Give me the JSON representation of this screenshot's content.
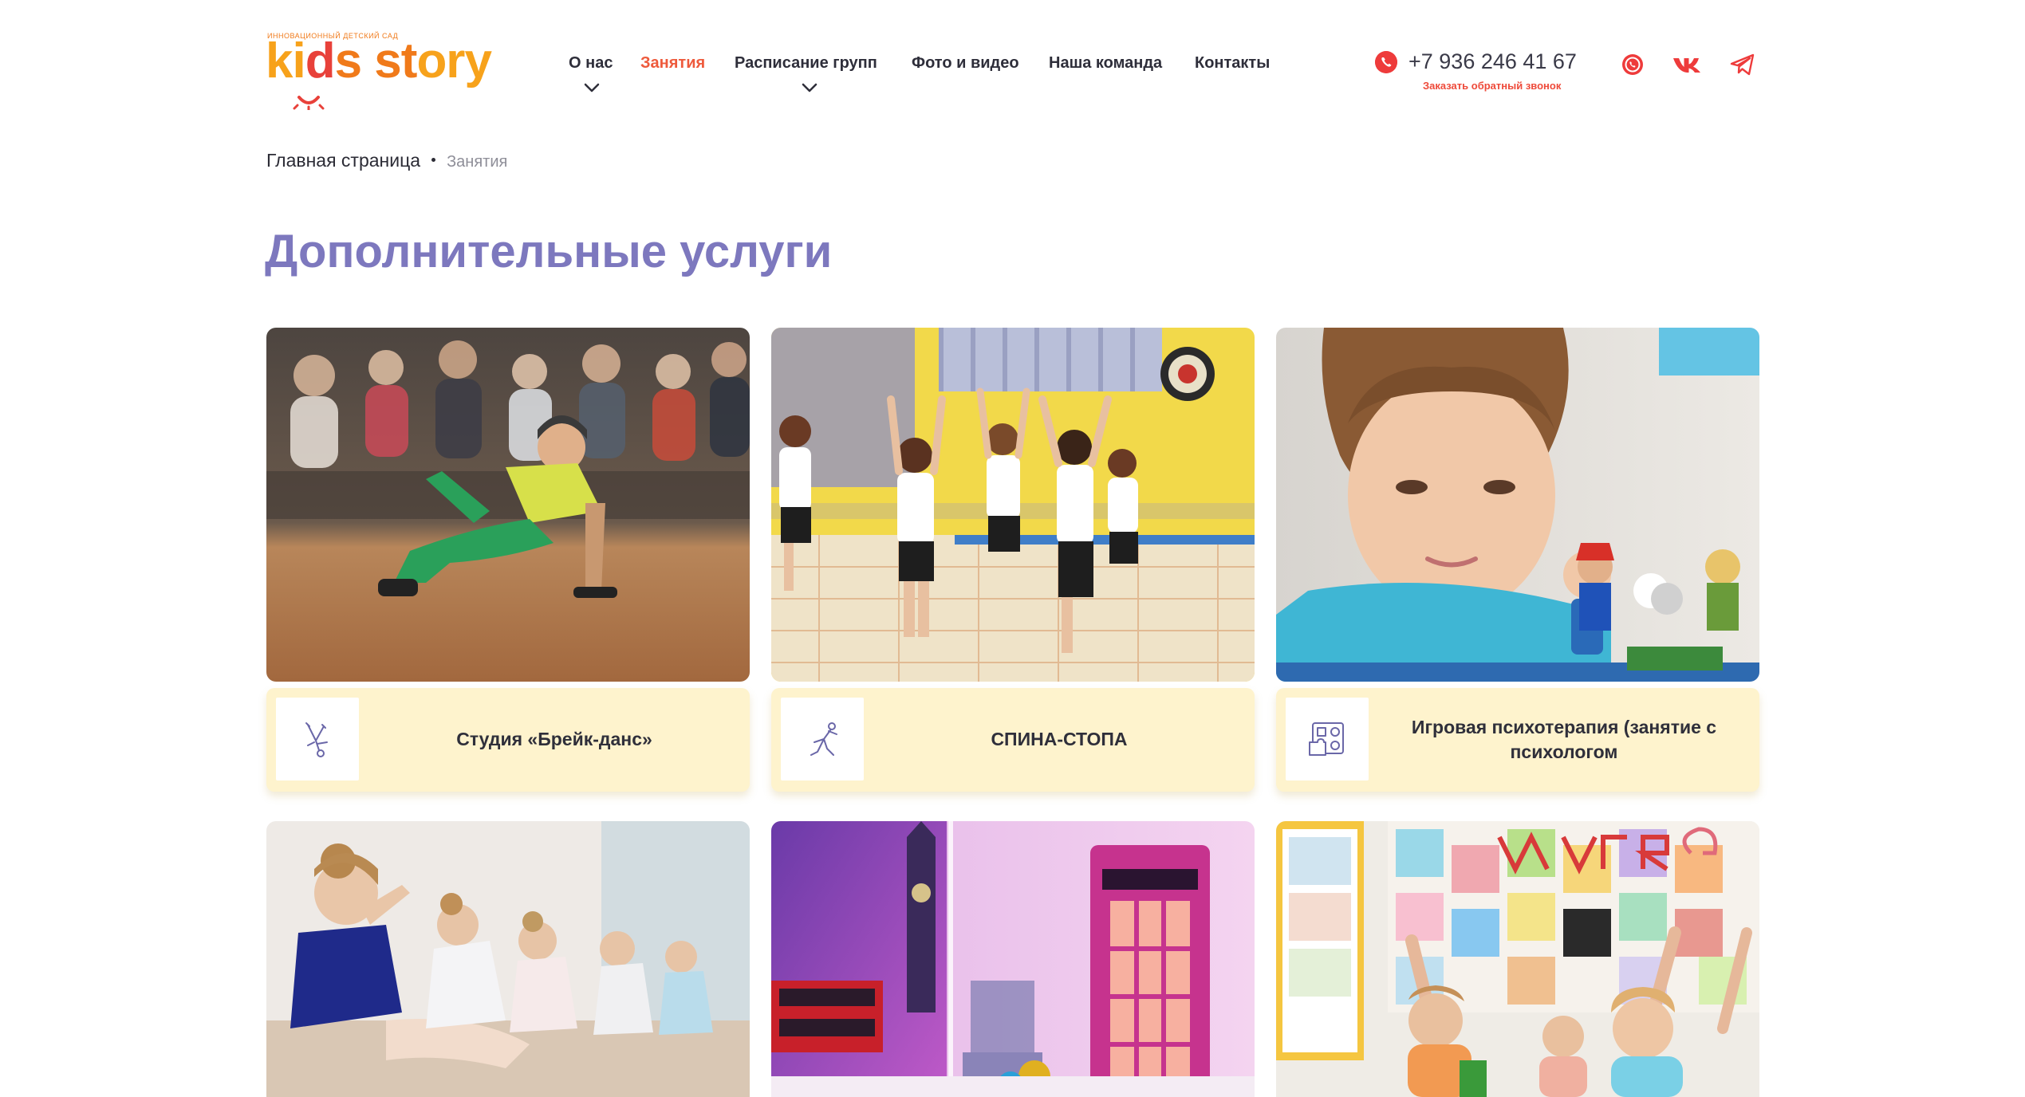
{
  "header": {
    "logo": {
      "tagline": "Инновационный детский сад",
      "word_part1": "ki",
      "word_part2": "d",
      "word_part3": "s st",
      "word_part4": "ory"
    },
    "nav": [
      {
        "label": "О нас",
        "has_dropdown": true,
        "active": false
      },
      {
        "label": "Занятия",
        "has_dropdown": false,
        "active": true
      },
      {
        "label": "Расписание групп",
        "has_dropdown": true,
        "active": false
      },
      {
        "label": "Фото и видео",
        "has_dropdown": false,
        "active": false
      },
      {
        "label": "Наша команда",
        "has_dropdown": false,
        "active": false
      },
      {
        "label": "Контакты",
        "has_dropdown": false,
        "active": false
      }
    ],
    "phone": "+7 936 246 41 67",
    "callback_label": "Заказать обратный звонок",
    "social_icons": [
      "whatsapp-icon",
      "vk-icon",
      "telegram-icon"
    ]
  },
  "breadcrumb": {
    "home": "Главная страница",
    "current": "Занятия"
  },
  "page_title": "Дополнительные услуги",
  "cards": [
    {
      "title": "Студия «Брейк-данс»",
      "icon": "breakdance-icon",
      "image": "boy breakdancing in a gym"
    },
    {
      "title": "СПИНА-СТОПА",
      "icon": "stretching-icon",
      "image": "children exercising in a yellow gym"
    },
    {
      "title": "Игровая психотерапия (занятие с психологом",
      "icon": "puzzle-icon",
      "image": "toddler playing with toy figures"
    },
    {
      "title": "",
      "icon": "",
      "image": "girls stretching in ballet class"
    },
    {
      "title": "",
      "icon": "",
      "image": "salt room with London telephone booth"
    },
    {
      "title": "",
      "icon": "",
      "image": "kids raising hands in a classroom"
    }
  ],
  "colors": {
    "accent": "#ee5a3c",
    "title": "#7d78be",
    "card_label_bg": "#fef3cd",
    "logo_yellow": "#f7a21b",
    "logo_orange": "#f07a1a",
    "logo_red": "#e8413a"
  }
}
